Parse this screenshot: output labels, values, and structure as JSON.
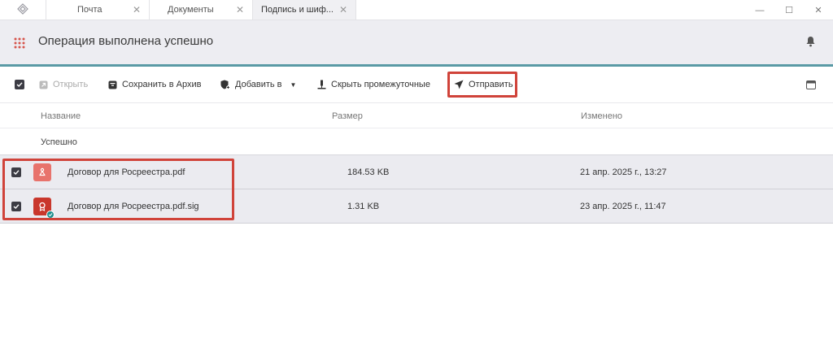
{
  "tabs": [
    {
      "label": "Почта"
    },
    {
      "label": "Документы"
    },
    {
      "label": "Подпись и шиф..."
    }
  ],
  "window_controls": {
    "minimize": "—",
    "maximize": "☐",
    "close": "✕"
  },
  "header": {
    "title": "Операция выполнена успешно"
  },
  "toolbar": {
    "open_label": "Открыть",
    "archive_label": "Сохранить в Архив",
    "add_label": "Добавить в",
    "hide_label": "Скрыть промежуточные",
    "send_label": "Отправить"
  },
  "table": {
    "columns": {
      "name": "Название",
      "size": "Размер",
      "modified": "Изменено"
    },
    "group_label": "Успешно",
    "rows": [
      {
        "name": "Договор для Росреестра.pdf",
        "size": "184.53 KB",
        "modified": "21 апр. 2025 г., 13:27",
        "icon": "pdf-icon"
      },
      {
        "name": "Договор для Росреестра.pdf.sig",
        "size": "1.31 KB",
        "modified": "23 апр. 2025 г., 11:47",
        "icon": "signature-file-icon"
      }
    ]
  },
  "colors": {
    "accent": "#5a9aa5",
    "highlight": "#d0433a",
    "pdf": "#e8736c",
    "sig": "#c9372c"
  }
}
